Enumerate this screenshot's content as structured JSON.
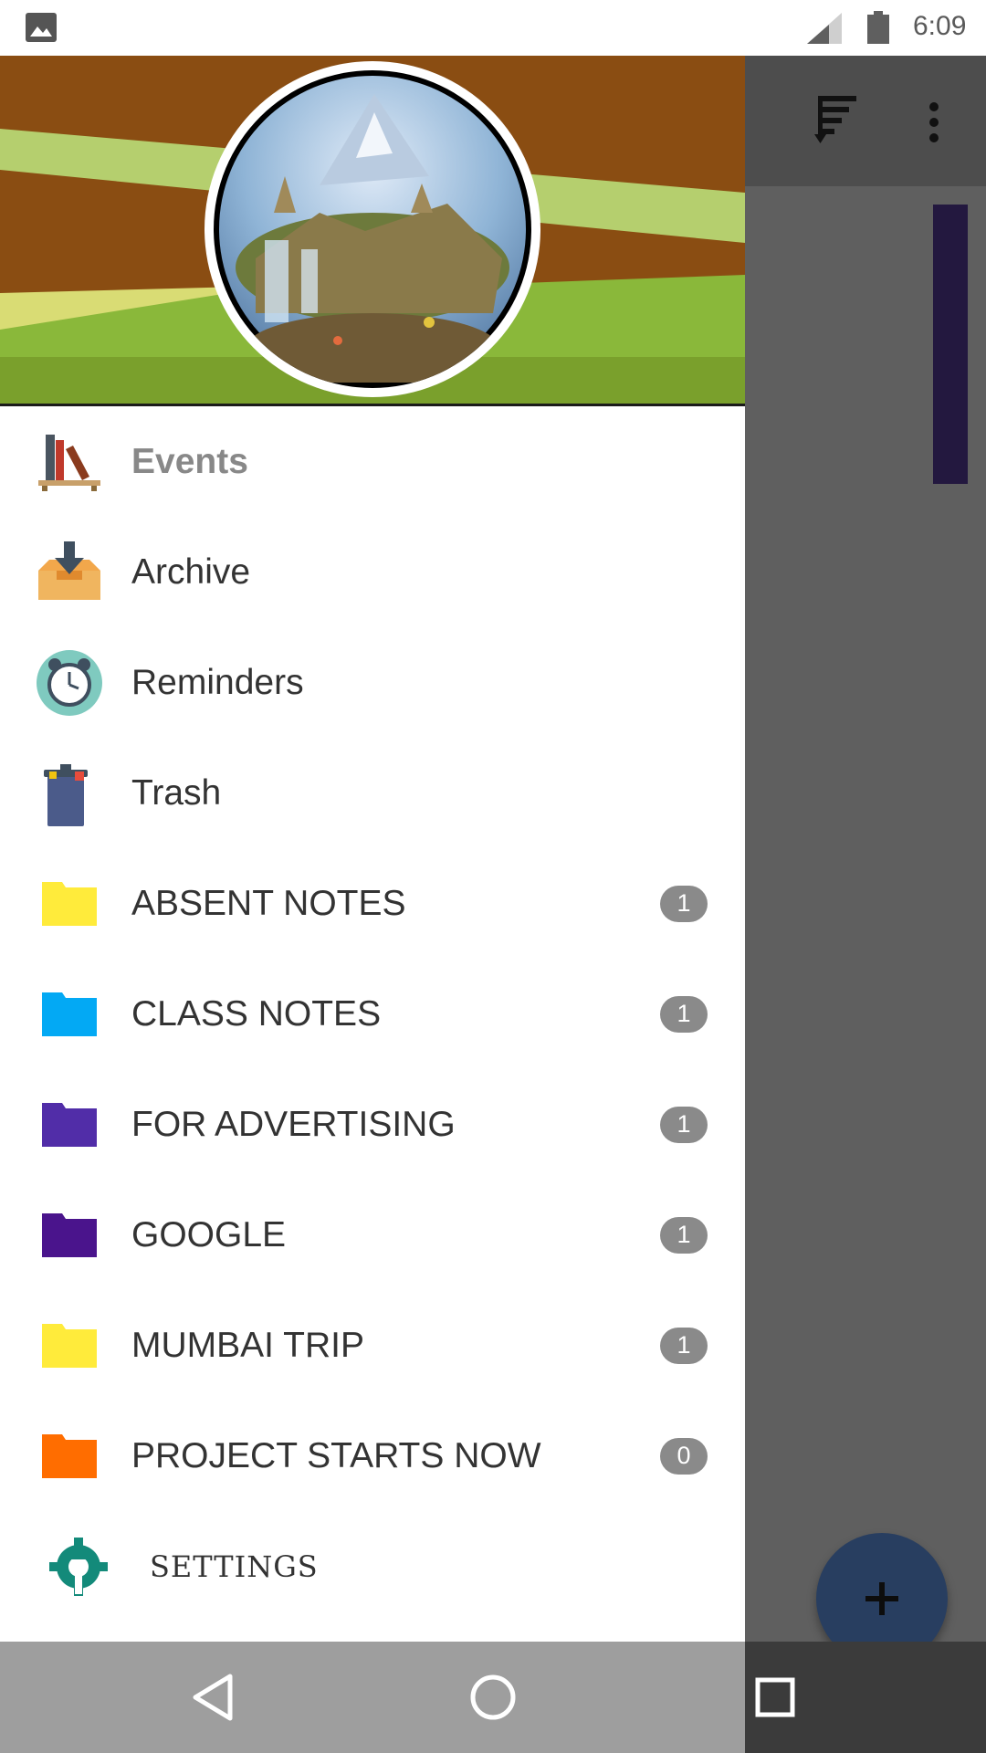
{
  "status_bar": {
    "time": "6:09"
  },
  "drawer": {
    "items": [
      {
        "label": "Events",
        "icon": "bookshelf-icon"
      },
      {
        "label": "Archive",
        "icon": "archive-box-icon"
      },
      {
        "label": "Reminders",
        "icon": "alarm-clock-icon"
      },
      {
        "label": "Trash",
        "icon": "trash-bin-icon"
      }
    ],
    "categories": [
      {
        "label": "ABSENT NOTES",
        "count": "1",
        "color": "#FFEB3B"
      },
      {
        "label": "CLASS NOTES",
        "count": "1",
        "color": "#03A9F4"
      },
      {
        "label": "FOR ADVERTISING",
        "count": "1",
        "color": "#512DA8"
      },
      {
        "label": "GOOGLE",
        "count": "1",
        "color": "#4A148C"
      },
      {
        "label": "MUMBAI TRIP",
        "count": "1",
        "color": "#FFEB3B"
      },
      {
        "label": "PROJECT STARTS NOW",
        "count": "0",
        "color": "#FF6D00"
      }
    ],
    "settings_label": "SETTINGS"
  },
  "colors": {
    "folder_yellow": "#FFEB3B",
    "folder_blue": "#03A9F4",
    "folder_purple": "#512DA8",
    "folder_dark_purple": "#4A148C",
    "folder_orange": "#FF6D00",
    "fab": "#283E60",
    "badge": "#8A8A8A"
  }
}
